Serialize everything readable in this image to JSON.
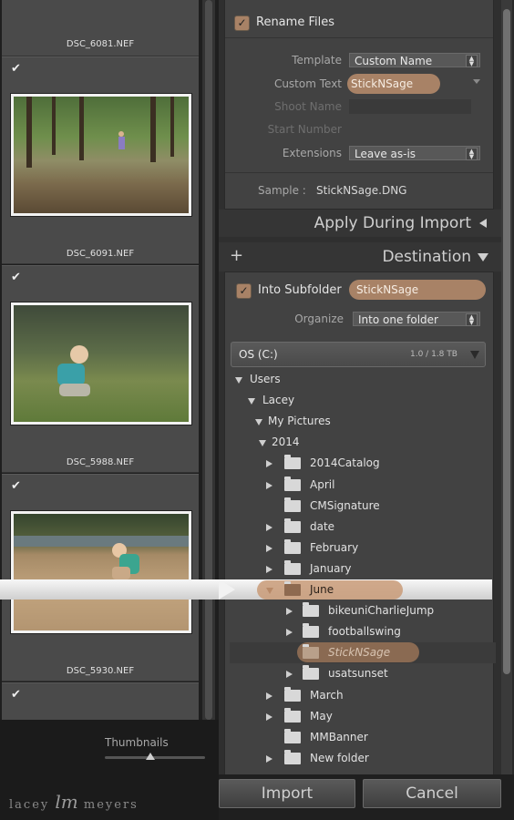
{
  "grid": {
    "cells": [
      {
        "checked": true,
        "checkmark": "✔",
        "filename": "DSC_6081.NEF"
      },
      {
        "checked": true,
        "checkmark": "✔",
        "filename": "DSC_6091.NEF"
      },
      {
        "checked": true,
        "checkmark": "✔",
        "filename": "DSC_5988.NEF"
      },
      {
        "checked": true,
        "checkmark": "✔",
        "filename": "DSC_5930.NEF"
      },
      {
        "checked": true,
        "checkmark": "✔"
      }
    ],
    "thumbnails_label": "Thumbnails",
    "thumbnail_size_level": 0.45
  },
  "branding": {
    "logo_left": "lacey",
    "logo_script": "lm",
    "logo_right": "meyers"
  },
  "rename": {
    "enabled": true,
    "title": "Rename Files",
    "template_label": "Template",
    "template_value": "Custom Name",
    "custom_text_label": "Custom Text",
    "custom_text_value": "StickNSage",
    "shoot_name_label": "Shoot Name",
    "start_number_label": "Start Number",
    "extensions_label": "Extensions",
    "extensions_value": "Leave as-is",
    "sample_label": "Sample :",
    "sample_value": "StickNSage.DNG"
  },
  "apply_during_import": {
    "title": "Apply During Import"
  },
  "destination": {
    "title": "Destination",
    "add_icon": "+",
    "into_subfolder_label": "Into Subfolder",
    "into_subfolder_enabled": true,
    "subfolder_value": "StickNSage",
    "organize_label": "Organize",
    "organize_value": "Into one folder",
    "volume_name": "OS (C:)",
    "volume_space": "1.0 / 1.8 TB",
    "tree": [
      {
        "label": "Users",
        "level": 0,
        "arrow": "down",
        "folder": false
      },
      {
        "label": "Lacey",
        "level": 1,
        "arrow": "down",
        "folder": false
      },
      {
        "label": "My Pictures",
        "level": 2,
        "arrow": "down",
        "folder": false
      },
      {
        "label": "2014",
        "level": 3,
        "arrow": "down",
        "folder": false
      },
      {
        "label": "2014Catalog",
        "level": 4,
        "arrow": "right",
        "folder": true
      },
      {
        "label": "April",
        "level": 4,
        "arrow": "right",
        "folder": true
      },
      {
        "label": "CMSignature",
        "level": 4,
        "arrow": "none",
        "folder": true
      },
      {
        "label": "date",
        "level": 4,
        "arrow": "right",
        "folder": true
      },
      {
        "label": "February",
        "level": 4,
        "arrow": "right",
        "folder": true
      },
      {
        "label": "January",
        "level": 4,
        "arrow": "right",
        "folder": true
      },
      {
        "label": "June",
        "level": 4,
        "arrow": "down",
        "folder": true,
        "selected": true
      },
      {
        "label": "bikeuniCharlieJump",
        "level": 5,
        "arrow": "right",
        "folder": true
      },
      {
        "label": "footballswing",
        "level": 5,
        "arrow": "right",
        "folder": true
      },
      {
        "label": "StickNSage",
        "level": 5,
        "arrow": "none",
        "folder": true,
        "new": true
      },
      {
        "label": "usatsunset",
        "level": 5,
        "arrow": "right",
        "folder": true
      },
      {
        "label": "March",
        "level": 4,
        "arrow": "right",
        "folder": true
      },
      {
        "label": "May",
        "level": 4,
        "arrow": "right",
        "folder": true
      },
      {
        "label": "MMBanner",
        "level": 4,
        "arrow": "none",
        "folder": true
      },
      {
        "label": "New folder",
        "level": 4,
        "arrow": "right",
        "folder": true
      }
    ]
  },
  "actions": {
    "import_label": "Import",
    "cancel_label": "Cancel"
  },
  "colors": {
    "accent": "#a88266",
    "panel": "#424242",
    "highlight": "#f2f2f2"
  }
}
